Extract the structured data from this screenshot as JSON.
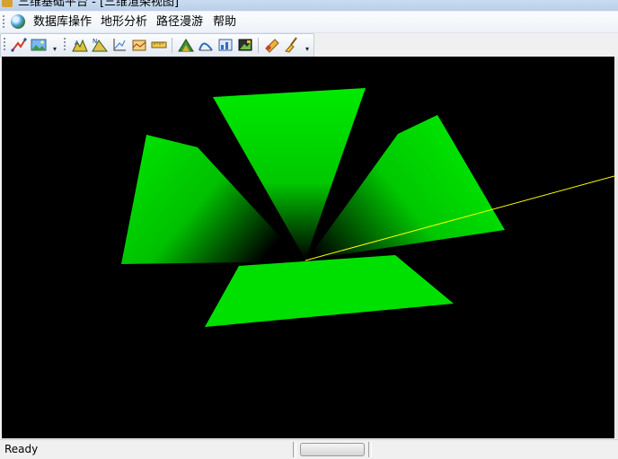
{
  "window": {
    "title": "三维基础平台 - [三维渲染视图]"
  },
  "menu": {
    "items": [
      {
        "label": "数据库操作"
      },
      {
        "label": "地形分析"
      },
      {
        "label": "路径漫游"
      },
      {
        "label": "帮助"
      }
    ]
  },
  "toolbar": {
    "buttons": [
      "line-draw-icon",
      "image-icon",
      "terrain-a-icon",
      "terrain-n-icon",
      "coordinate-icon",
      "profile-icon",
      "ruler-icon",
      "slope-icon",
      "section-icon",
      "chart-icon",
      "layer-icon",
      "fly-icon",
      "broom-icon"
    ]
  },
  "viewport": {
    "background": "#000000",
    "mesh_color": "#00e000",
    "line_color": "#ffff00"
  },
  "status": {
    "text": "Ready"
  }
}
